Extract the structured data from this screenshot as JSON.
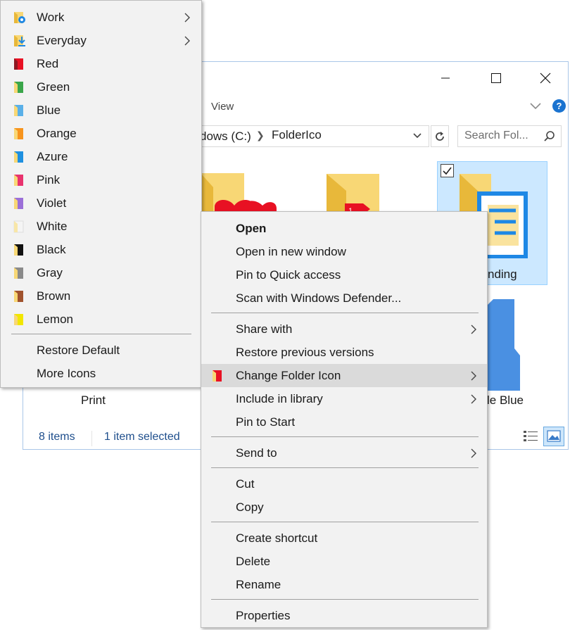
{
  "explorer": {
    "view_tab": "View",
    "address_path": "dows (C:)",
    "address_folder": "FolderIco",
    "search_placeholder": "Search Fol...",
    "items": [
      {
        "label": "Print"
      },
      {
        "label": "nding"
      },
      {
        "label": "le Blue"
      }
    ],
    "status_count": "8 items",
    "status_selected": "1 item selected"
  },
  "submenu": {
    "items": [
      {
        "label": "Work",
        "icon": "work-folder-icon",
        "has_submenu": true
      },
      {
        "label": "Everyday",
        "icon": "everyday-folder-icon",
        "has_submenu": true
      },
      {
        "label": "Red",
        "icon": "red-folder-icon",
        "color": "#e81123"
      },
      {
        "label": "Green",
        "icon": "green-folder-icon",
        "color": "#3aa64a"
      },
      {
        "label": "Blue",
        "icon": "blue-folder-icon",
        "color": "#5ab0e8"
      },
      {
        "label": "Orange",
        "icon": "orange-folder-icon",
        "color": "#f7941d"
      },
      {
        "label": "Azure",
        "icon": "azure-folder-icon",
        "color": "#1e90e0"
      },
      {
        "label": "Pink",
        "icon": "pink-folder-icon",
        "color": "#e8336e"
      },
      {
        "label": "Violet",
        "icon": "violet-folder-icon",
        "color": "#9b6fd8"
      },
      {
        "label": "White",
        "icon": "white-folder-icon",
        "color": "#f4f4f4"
      },
      {
        "label": "Black",
        "icon": "black-folder-icon",
        "color": "#111111"
      },
      {
        "label": "Gray",
        "icon": "gray-folder-icon",
        "color": "#8a8a8a"
      },
      {
        "label": "Brown",
        "icon": "brown-folder-icon",
        "color": "#a0522d"
      },
      {
        "label": "Lemon",
        "icon": "lemon-folder-icon",
        "color": "#f2e600"
      }
    ],
    "restore_default": "Restore Default",
    "more_icons": "More Icons"
  },
  "context_menu": {
    "open": "Open",
    "open_new_window": "Open in new window",
    "pin_quick_access": "Pin to Quick access",
    "scan_defender": "Scan with Windows Defender...",
    "share_with": "Share with",
    "restore_versions": "Restore previous versions",
    "change_folder_icon": "Change Folder Icon",
    "include_library": "Include in library",
    "pin_start": "Pin to Start",
    "send_to": "Send to",
    "cut": "Cut",
    "copy": "Copy",
    "create_shortcut": "Create shortcut",
    "delete": "Delete",
    "rename": "Rename",
    "properties": "Properties"
  },
  "colors": {
    "folder_yellow": "#f8d775",
    "folder_yellow_dark": "#e8b83a",
    "selection_fill": "#cce8ff",
    "accent_blue": "#1e88e5"
  }
}
